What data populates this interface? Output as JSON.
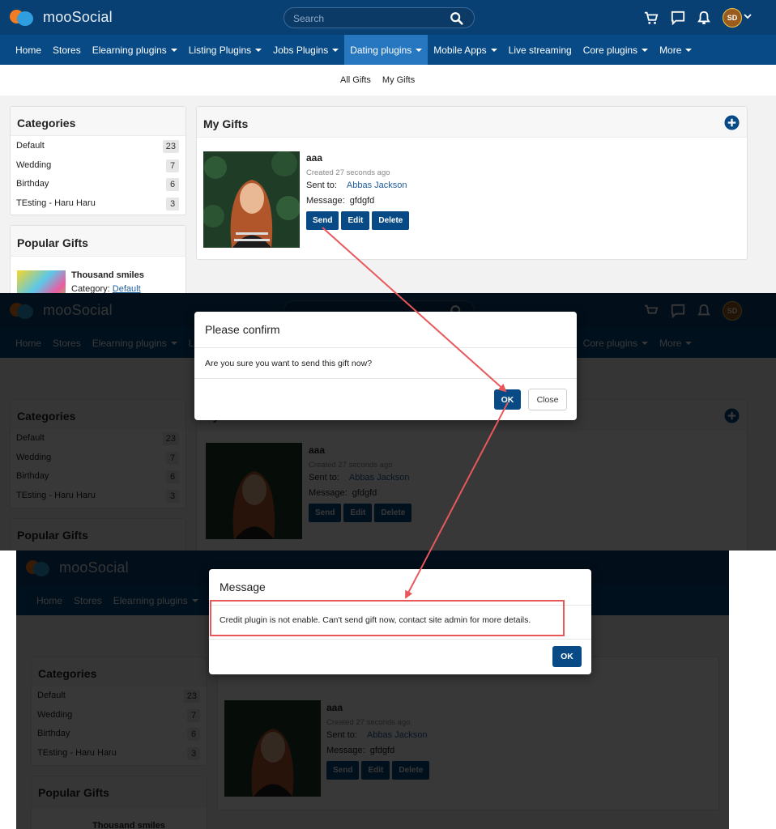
{
  "header": {
    "brand": "mooSocial",
    "search_placeholder": "Search",
    "avatar_initials": "SD"
  },
  "nav": {
    "items": [
      {
        "label": "Home",
        "dropdown": false,
        "active": false
      },
      {
        "label": "Stores",
        "dropdown": false,
        "active": false
      },
      {
        "label": "Elearning plugins",
        "dropdown": true,
        "active": false
      },
      {
        "label": "Listing Plugins",
        "dropdown": true,
        "active": false
      },
      {
        "label": "Jobs Plugins",
        "dropdown": true,
        "active": false
      },
      {
        "label": "Dating plugins",
        "dropdown": true,
        "active": true
      },
      {
        "label": "Mobile Apps",
        "dropdown": true,
        "active": false
      },
      {
        "label": "Live streaming",
        "dropdown": false,
        "active": false
      },
      {
        "label": "Core plugins",
        "dropdown": true,
        "active": false
      },
      {
        "label": "More",
        "dropdown": true,
        "active": false
      }
    ]
  },
  "subnav": {
    "all_gifts": "All Gifts",
    "my_gifts": "My Gifts"
  },
  "categories": {
    "title": "Categories",
    "items": [
      {
        "name": "Default",
        "count": "23"
      },
      {
        "name": "Wedding",
        "count": "7"
      },
      {
        "name": "Birthday",
        "count": "6"
      },
      {
        "name": "TEsting - Haru Haru",
        "count": "3"
      }
    ]
  },
  "popular": {
    "title": "Popular Gifts",
    "item_name": "Thousand smiles",
    "category_label": "Category:",
    "category_value": "Default"
  },
  "mygifts": {
    "title": "My Gifts",
    "gift": {
      "name": "aaa",
      "created": "Created 27 seconds ago",
      "sent_to_label": "Sent to:",
      "sent_to_value": "Abbas Jackson",
      "message_label": "Message:",
      "message_value": "gfdgfd",
      "send": "Send",
      "edit": "Edit",
      "delete": "Delete"
    }
  },
  "confirm_dialog": {
    "title": "Please confirm",
    "body": "Are you sure you want to send this gift now?",
    "ok": "OK",
    "close": "Close"
  },
  "message_dialog": {
    "title": "Message",
    "body": "Credit plugin is not enable. Can't send gift now, contact site admin for more details.",
    "ok": "OK"
  },
  "colors": {
    "header": "#094073",
    "navbar": "#074a85",
    "nav_active": "#2677c0",
    "primary_button": "#074a85",
    "annotation": "#e8585b"
  }
}
